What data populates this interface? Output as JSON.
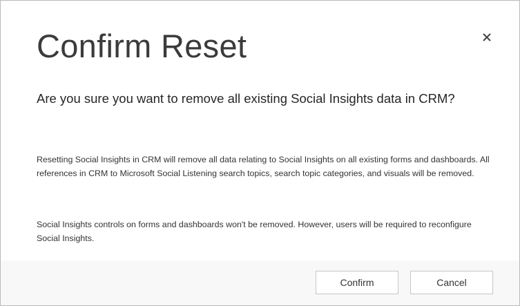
{
  "dialog": {
    "title": "Confirm Reset",
    "close_icon": "close-icon",
    "question": "Are you sure you want to remove all existing Social Insights data in CRM?",
    "paragraphs": [
      "Resetting Social Insights in CRM will remove all data relating to Social Insights on all existing forms and dashboards. All references in CRM to Microsoft Social Listening search topics, search topic categories, and visuals will be removed.",
      "Social Insights controls on forms and dashboards won't be removed. However, users will be required to reconfigure Social Insights."
    ],
    "buttons": {
      "confirm_label": "Confirm",
      "cancel_label": "Cancel"
    }
  },
  "colors": {
    "footer_background": "#f8f8f8",
    "border": "#b9b9b9",
    "text": "#262626"
  }
}
